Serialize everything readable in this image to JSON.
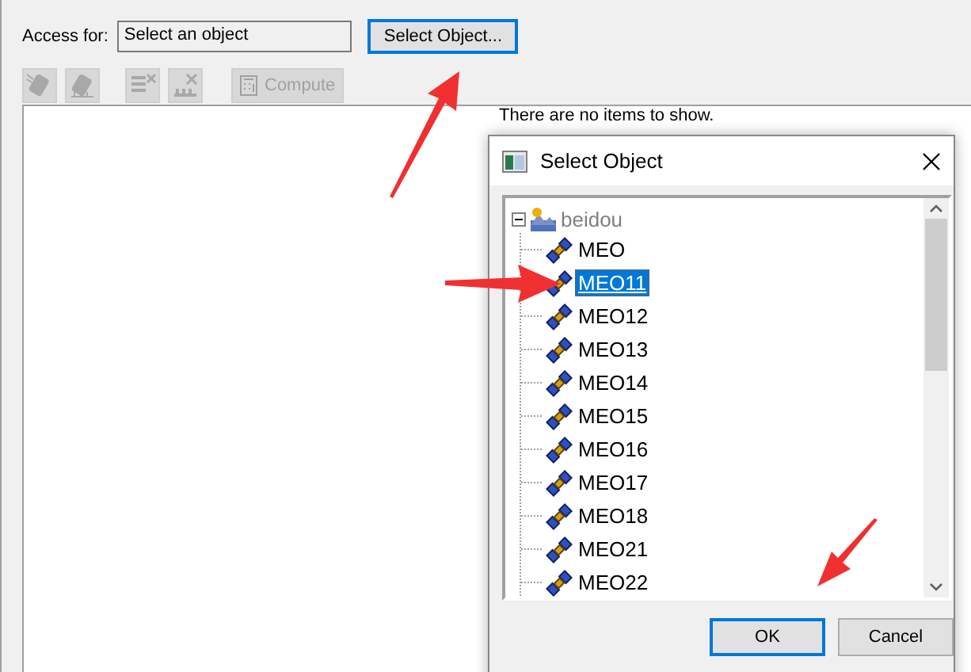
{
  "access_field": {
    "label": "Access for:",
    "value": "Select an object"
  },
  "select_button": {
    "label": "Select Object...",
    "focused": true
  },
  "toolbar": [
    {
      "disabled": true
    },
    {
      "disabled": true
    },
    {
      "disabled": true
    },
    {
      "disabled": true
    },
    {
      "label": "Compute",
      "disabled": true
    }
  ],
  "list": {
    "empty_message": "There are no items to show."
  },
  "dialog": {
    "title": "Select Object",
    "tree": {
      "label": "beidou",
      "expanded": true,
      "children": [
        {
          "label": "MEO",
          "selected": false
        },
        {
          "label": "MEO11",
          "selected": true
        },
        {
          "label": "MEO12",
          "selected": false
        },
        {
          "label": "MEO13",
          "selected": false
        },
        {
          "label": "MEO14",
          "selected": false
        },
        {
          "label": "MEO15",
          "selected": false
        },
        {
          "label": "MEO16",
          "selected": false
        },
        {
          "label": "MEO17",
          "selected": false
        },
        {
          "label": "MEO18",
          "selected": false
        },
        {
          "label": "MEO21",
          "selected": false
        },
        {
          "label": "MEO22",
          "selected": false
        }
      ]
    },
    "buttons": [
      {
        "label": "OK",
        "default": true
      },
      {
        "label": "Cancel",
        "default": false
      }
    ]
  }
}
